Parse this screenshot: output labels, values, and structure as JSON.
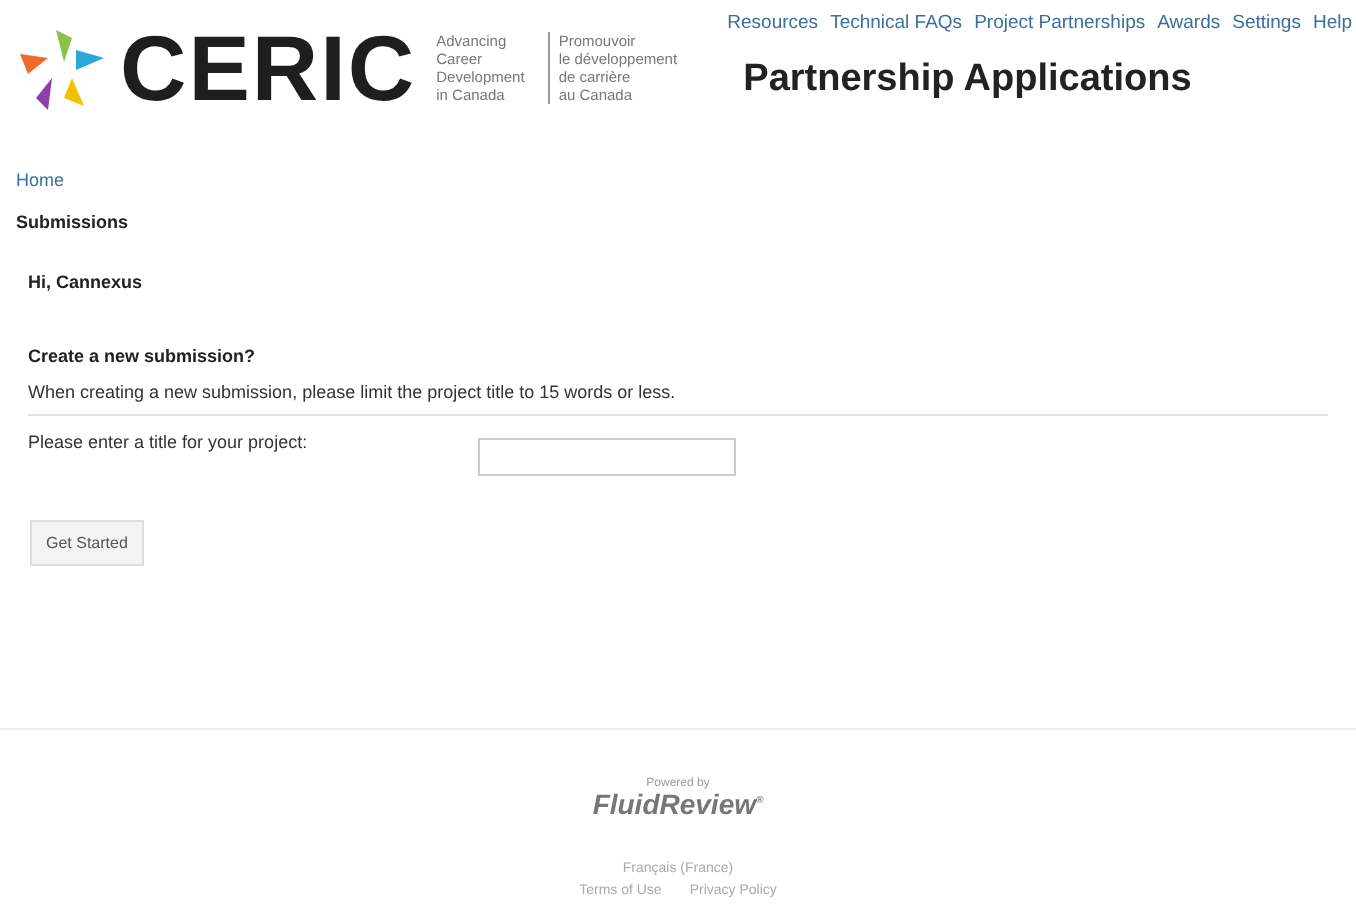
{
  "logo": {
    "wordmark": "CERIC",
    "tagline_en": [
      "Advancing",
      "Career",
      "Development",
      "in Canada"
    ],
    "tagline_fr": [
      "Promouvoir",
      "le développement",
      "de carrière",
      "au Canada"
    ]
  },
  "nav": [
    "Resources",
    "Technical FAQs",
    "Project Partnerships",
    "Awards",
    "Settings",
    "Help"
  ],
  "page_title": "Partnership Applications",
  "breadcrumb": "Home",
  "section": "Submissions",
  "greeting": "Hi, Cannexus",
  "form": {
    "heading": "Create a new submission?",
    "instruction": "When creating a new submission, please limit the project title to 15 words or less.",
    "label": "Please enter a title for your project:",
    "button": "Get Started"
  },
  "footer": {
    "powered_by": "Powered by",
    "brand": "FluidReview",
    "brand_mark": "®",
    "language": "Français (France)",
    "links": [
      "Terms of Use",
      "Privacy Policy"
    ]
  }
}
